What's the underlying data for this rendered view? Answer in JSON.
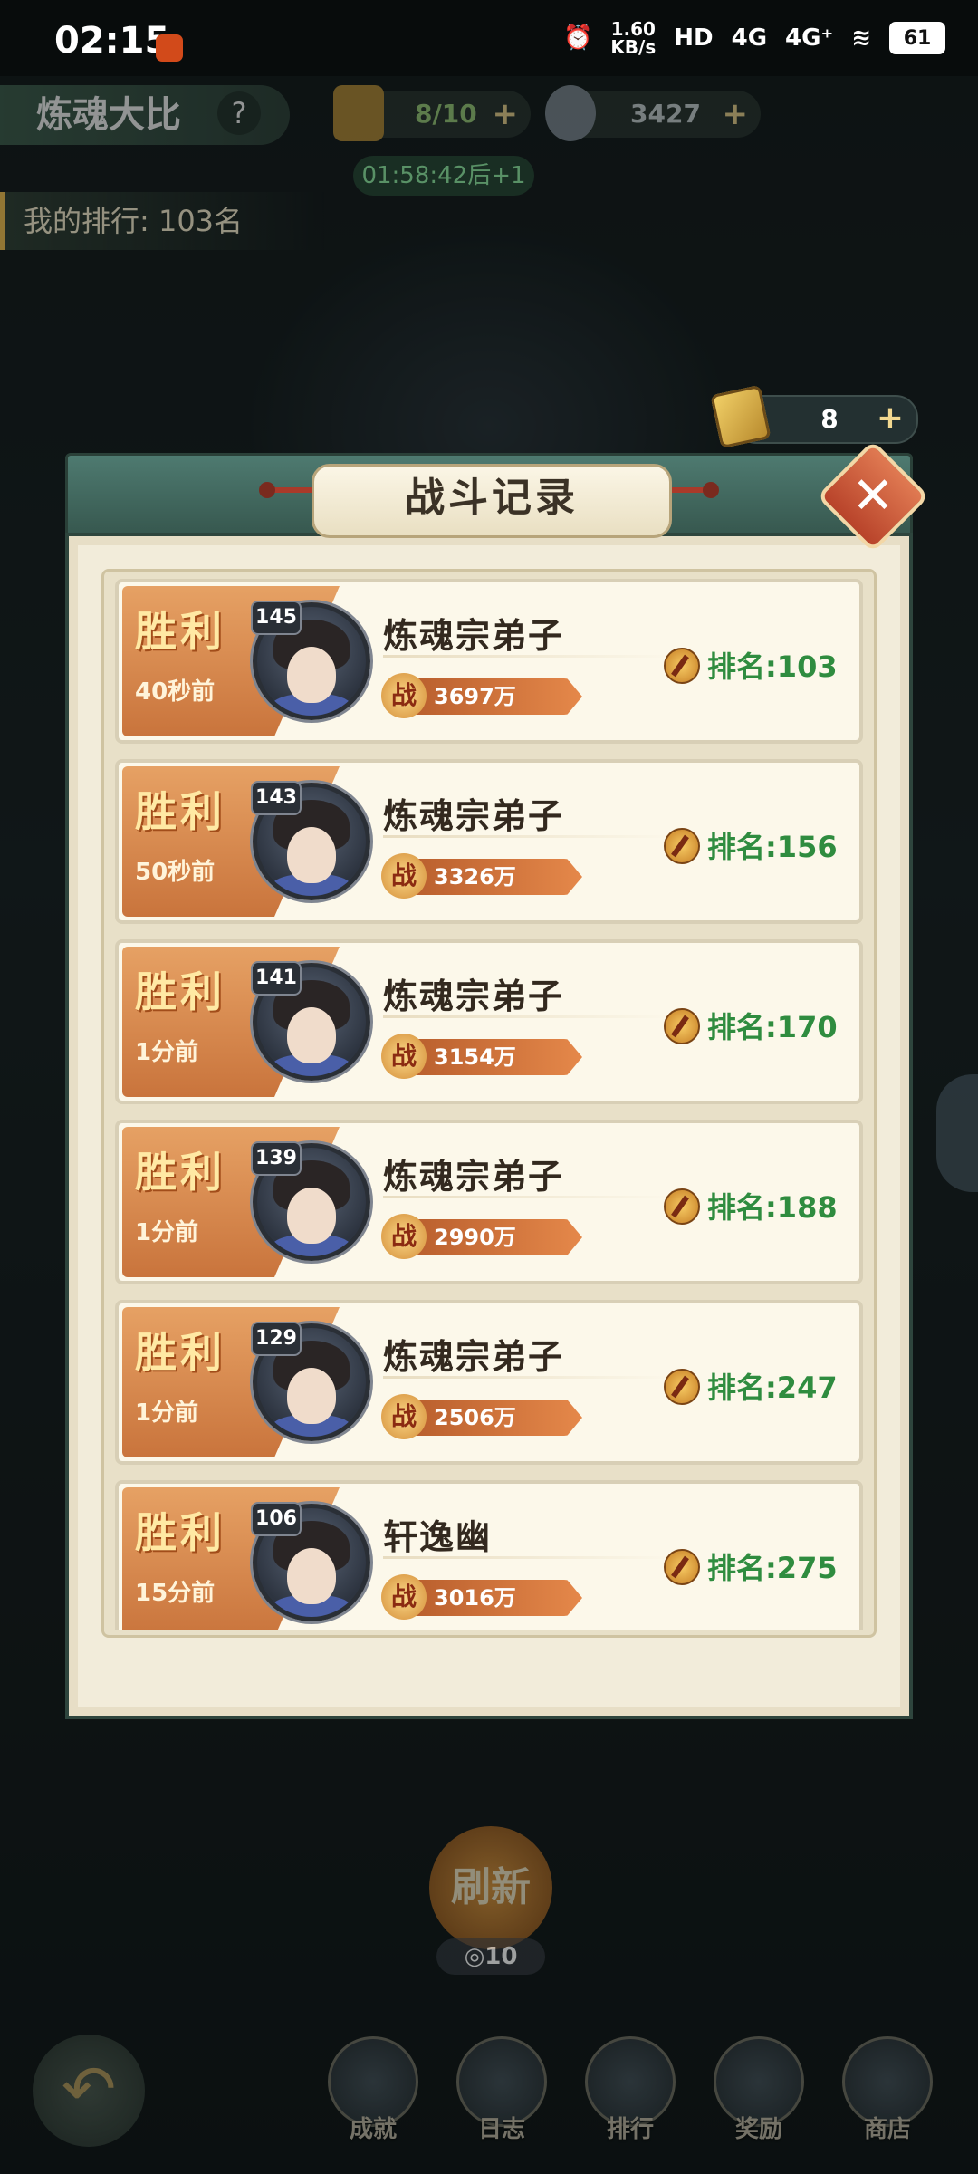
{
  "status_bar": {
    "time": "02:15",
    "net_speed_value": "1.60",
    "net_speed_unit": "KB/s",
    "hd": "HD",
    "signal1": "4G",
    "signal2": "4G⁺",
    "battery": "61"
  },
  "header": {
    "title": "炼魂大比",
    "help": "?",
    "stamina": "8/10",
    "currency": "3427",
    "timer": "01:58:42后+1",
    "my_rank": "我的排行: 103名"
  },
  "key_counter": {
    "count": "8",
    "plus": "+"
  },
  "dialog": {
    "title": "战斗记录",
    "close": "✕",
    "records": [
      {
        "result": "胜利",
        "ago": "40秒前",
        "level": "145",
        "name": "炼魂宗弟子",
        "power_icon": "战",
        "power": "3697万",
        "rank": "排名:103"
      },
      {
        "result": "胜利",
        "ago": "50秒前",
        "level": "143",
        "name": "炼魂宗弟子",
        "power_icon": "战",
        "power": "3326万",
        "rank": "排名:156"
      },
      {
        "result": "胜利",
        "ago": "1分前",
        "level": "141",
        "name": "炼魂宗弟子",
        "power_icon": "战",
        "power": "3154万",
        "rank": "排名:170"
      },
      {
        "result": "胜利",
        "ago": "1分前",
        "level": "139",
        "name": "炼魂宗弟子",
        "power_icon": "战",
        "power": "2990万",
        "rank": "排名:188"
      },
      {
        "result": "胜利",
        "ago": "1分前",
        "level": "129",
        "name": "炼魂宗弟子",
        "power_icon": "战",
        "power": "2506万",
        "rank": "排名:247"
      },
      {
        "result": "胜利",
        "ago": "15分前",
        "level": "106",
        "name": "轩逸幽",
        "power_icon": "战",
        "power": "3016万",
        "rank": "排名:275"
      }
    ]
  },
  "refresh": {
    "label": "刷新",
    "cost": "10"
  },
  "bottom_nav": [
    {
      "label": "成就",
      "icon": "achievement-icon"
    },
    {
      "label": "日志",
      "icon": "log-icon"
    },
    {
      "label": "排行",
      "icon": "ranking-icon"
    },
    {
      "label": "奖励",
      "icon": "reward-icon"
    },
    {
      "label": "商店",
      "icon": "shop-icon"
    }
  ],
  "colors": {
    "rank_green": "#2f8c3f",
    "result_gold": "#ffe9a4",
    "dialog_header": "#4e7a70"
  }
}
